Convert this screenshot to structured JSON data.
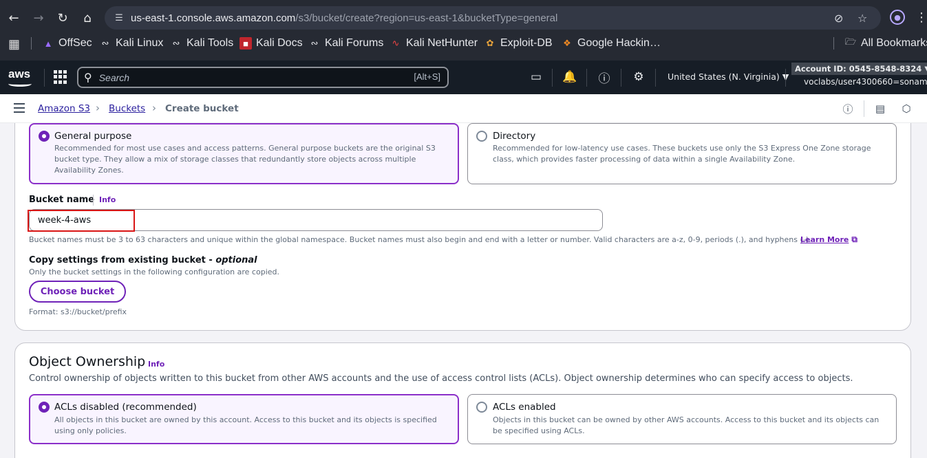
{
  "browser": {
    "url_host": "us-east-1.console.aws.amazon.com",
    "url_path": "/s3/bucket/create?region=us-east-1&bucketType=general",
    "bookmarks": [
      {
        "label": "OffSec",
        "icon": "offsec-icon"
      },
      {
        "label": "Kali Linux",
        "icon": "kali-icon"
      },
      {
        "label": "Kali Tools",
        "icon": "kali-icon"
      },
      {
        "label": "Kali Docs",
        "icon": "kali-docs-icon"
      },
      {
        "label": "Kali Forums",
        "icon": "kali-icon"
      },
      {
        "label": "Kali NetHunter",
        "icon": "nethunter-icon"
      },
      {
        "label": "Exploit-DB",
        "icon": "exploit-db-icon"
      },
      {
        "label": "Google Hackin…",
        "icon": "ghdb-icon"
      }
    ],
    "all_bookmarks": "All Bookmarks"
  },
  "aws": {
    "logo": "aws",
    "search_placeholder": "Search",
    "search_shortcut": "[Alt+S]",
    "region": "United States (N. Virginia)",
    "account": "Account ID: 0545-8548-8324",
    "user": "voclabs/user4300660=sonam"
  },
  "breadcrumb": {
    "items": [
      "Amazon S3",
      "Buckets"
    ],
    "current": "Create bucket"
  },
  "bucket_type": {
    "options": [
      {
        "title": "General purpose",
        "desc": "Recommended for most use cases and access patterns. General purpose buckets are the original S3 bucket type. They allow a mix of storage classes that redundantly store objects across multiple Availability Zones.",
        "selected": true
      },
      {
        "title": "Directory",
        "desc": "Recommended for low-latency use cases. These buckets use only the S3 Express One Zone storage class, which provides faster processing of data within a single Availability Zone.",
        "selected": false
      }
    ]
  },
  "bucket_name": {
    "label": "Bucket name",
    "info": "Info",
    "value": "week-4-aws",
    "help": "Bucket names must be 3 to 63 characters and unique within the global namespace. Bucket names must also begin and end with a letter or number. Valid characters are a-z, 0-9, periods (.), and hyphens (-).",
    "learn_more": "Learn More"
  },
  "copy_settings": {
    "label": "Copy settings from existing bucket - ",
    "label_optional": "optional",
    "desc": "Only the bucket settings in the following configuration are copied.",
    "button": "Choose bucket",
    "format": "Format: s3://bucket/prefix"
  },
  "object_ownership": {
    "title": "Object Ownership",
    "info": "Info",
    "desc": "Control ownership of objects written to this bucket from other AWS accounts and the use of access control lists (ACLs). Object ownership determines who can specify access to objects.",
    "options": [
      {
        "title": "ACLs disabled (recommended)",
        "desc": "All objects in this bucket are owned by this account. Access to this bucket and its objects is specified using only policies.",
        "selected": true
      },
      {
        "title": "ACLs enabled",
        "desc": "Objects in this bucket can be owned by other AWS accounts. Access to this bucket and its objects can be specified using ACLs.",
        "selected": false
      }
    ]
  },
  "colors": {
    "accent": "#6f22b8",
    "highlight": "#d91515",
    "aws_nav": "#161d26"
  }
}
